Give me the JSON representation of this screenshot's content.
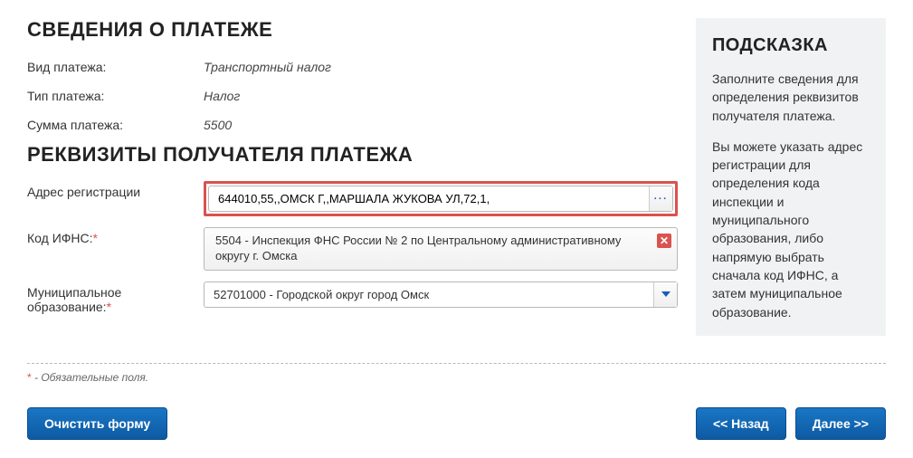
{
  "section_payment_title": "СВЕДЕНИЯ О ПЛАТЕЖЕ",
  "section_requisites_title": "РЕКВИЗИТЫ ПОЛУЧАТЕЛЯ ПЛАТЕЖА",
  "payment": {
    "kind_label": "Вид платежа:",
    "kind_value": "Транспортный налог",
    "type_label": "Тип платежа:",
    "type_value": "Налог",
    "sum_label": "Сумма платежа:",
    "sum_value": "5500"
  },
  "requisites": {
    "address_label": "Адрес регистрации",
    "address_value": "644010,55,,ОМСК Г,,МАРШАЛА ЖУКОВА УЛ,72,1,",
    "ifns_label": "Код ИФНС:",
    "ifns_value": "5504 - Инспекция ФНС России № 2 по Центральному административному округу г. Омска",
    "mun_label": "Муниципальное образование:",
    "mun_value": "52701000 - Городской округ город Омск"
  },
  "hint": {
    "title": "ПОДСКАЗКА",
    "p1": "Заполните сведения для определения реквизитов получателя платежа.",
    "p2": "Вы можете указать адрес регистрации для определения кода инспекции и муниципального образования, либо напрямую выбрать сначала код ИФНС, а затем муниципальное образование."
  },
  "footnote": "- Обязательные поля.",
  "buttons": {
    "clear": "Очистить форму",
    "back": "<< Назад",
    "next": "Далее >>"
  },
  "icons": {
    "ellipsis": "···"
  }
}
